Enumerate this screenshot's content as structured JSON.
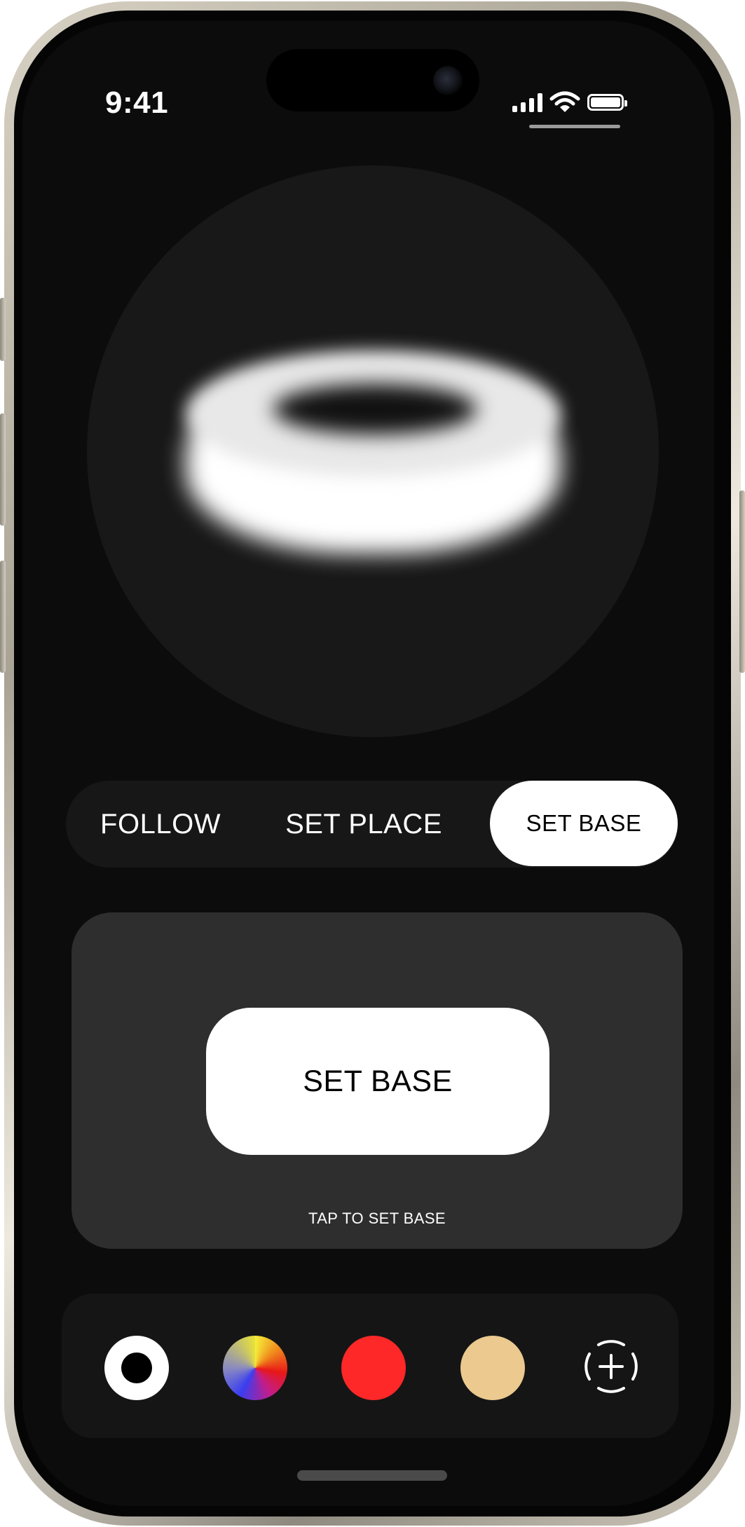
{
  "status_bar": {
    "time": "9:41"
  },
  "modes": {
    "tabs": [
      {
        "label": "FOLLOW",
        "active": false
      },
      {
        "label": "SET PLACE",
        "active": false
      },
      {
        "label": "SET BASE",
        "active": true
      }
    ]
  },
  "base_panel": {
    "button_label": "SET BASE",
    "hint": "TAP TO SET BASE"
  },
  "palette": {
    "swatches": [
      {
        "name": "white-ring",
        "color": "#ffffff"
      },
      {
        "name": "spectrum",
        "color": "multicolor"
      },
      {
        "name": "red",
        "color": "#ff2828"
      },
      {
        "name": "tan",
        "color": "#ebc98f"
      }
    ],
    "add_icon": "add-color-icon"
  },
  "colors": {
    "screen_background": "#0c0c0c",
    "card_background": "#2e2e2e",
    "accent": "#ffffff"
  }
}
